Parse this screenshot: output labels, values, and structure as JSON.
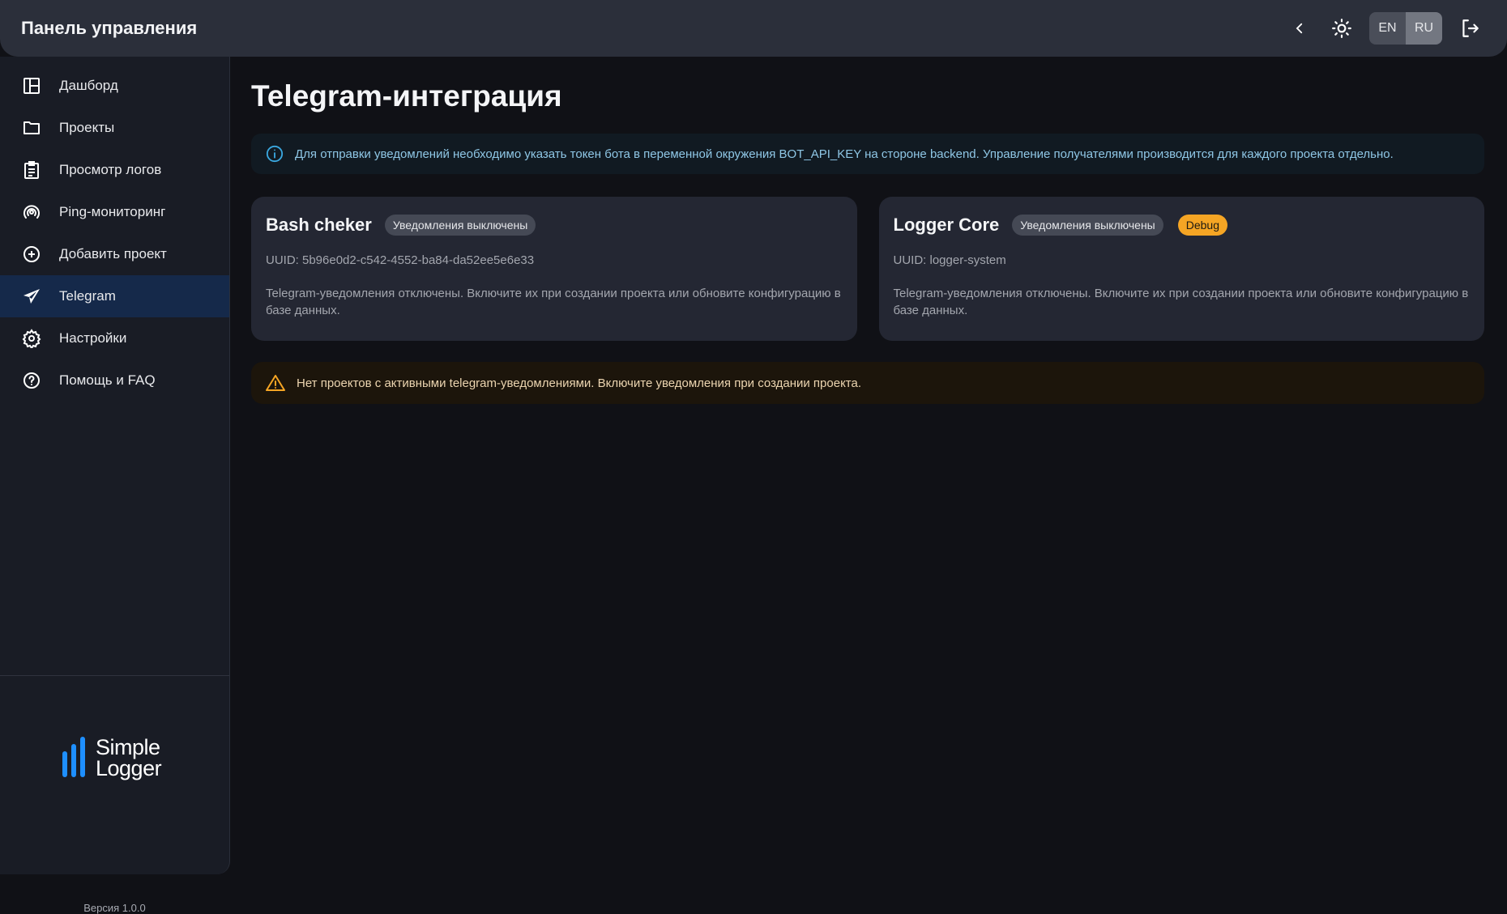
{
  "header": {
    "title": "Панель управления",
    "languages": [
      "EN",
      "RU"
    ],
    "active_language": "RU",
    "icons": [
      "chevron-left-icon",
      "sun-icon",
      "logout-icon"
    ]
  },
  "sidebar": {
    "items": [
      {
        "label": "Дашборд",
        "icon": "dashboard-icon"
      },
      {
        "label": "Проекты",
        "icon": "folder-icon"
      },
      {
        "label": "Просмотр логов",
        "icon": "clipboard-icon"
      },
      {
        "label": "Ping-мониторинг",
        "icon": "broadcast-icon"
      },
      {
        "label": "Добавить проект",
        "icon": "plus-circle-icon"
      },
      {
        "label": "Telegram",
        "icon": "send-icon",
        "active": true
      },
      {
        "label": "Настройки",
        "icon": "gear-icon"
      },
      {
        "label": "Помощь и FAQ",
        "icon": "help-icon"
      }
    ],
    "logo": {
      "line1": "Simple",
      "line2": "Logger",
      "color": "#1e8fff"
    },
    "version": "Версия 1.0.0"
  },
  "main": {
    "title": "Telegram-интеграция",
    "info": "Для отправки уведомлений необходимо указать токен бота в переменной окружения BOT_API_KEY на стороне backend. Управление получателями производится для каждого проекта отдельно.",
    "cards": [
      {
        "name": "Bash cheker",
        "status": "Уведомления выключены",
        "uuid": "UUID: 5b96e0d2-c542-4552-ba84-da52ee5e6e33",
        "description": "Telegram-уведомления отключены. Включите их при создании проекта или обновите конфигурацию в базе данных."
      },
      {
        "name": "Logger Core",
        "status": "Уведомления выключены",
        "tag": "Debug",
        "uuid": "UUID: logger-system",
        "description": "Telegram-уведомления отключены. Включите их при создании проекта или обновите конфигурацию в базе данных."
      }
    ],
    "warning": "Нет проектов с активными telegram-уведомлениями. Включите уведомления при создании проекта."
  },
  "colors": {
    "accent": "#1e8fff",
    "active_nav": "#15294a",
    "debug_badge": "#f5a524",
    "warning": "#f5a524",
    "info": "#3aa8e0"
  }
}
